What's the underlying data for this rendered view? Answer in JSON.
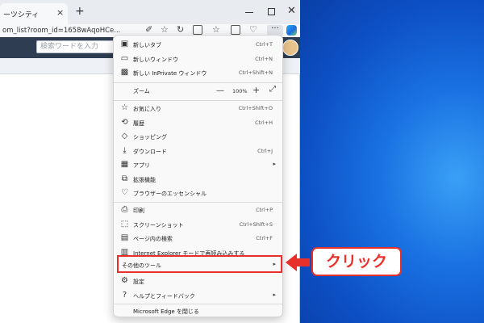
{
  "browser": {
    "tab_title": "ーツシティ",
    "tab_close": "×",
    "new_tab": "+",
    "url": "om_list?room_id=1658wAqoHCe...",
    "more_label": "···"
  },
  "site": {
    "search_placeholder": "検索ワードを入力"
  },
  "menu": {
    "items": [
      {
        "label": "新しいタブ",
        "shortcut": "Ctrl+T",
        "icon": "new-tab-icon"
      },
      {
        "label": "新しいウィンドウ",
        "shortcut": "Ctrl+N",
        "icon": "new-window-icon"
      },
      {
        "label": "新しい InPrivate ウィンドウ",
        "shortcut": "Ctrl+Shift+N",
        "icon": "inprivate-icon"
      },
      {
        "label": "ズーム",
        "zoom": "100%",
        "minus": "—",
        "plus": "+"
      },
      {
        "label": "お気に入り",
        "shortcut": "Ctrl+Shift+O",
        "icon": "favorites-icon"
      },
      {
        "label": "履歴",
        "shortcut": "Ctrl+H",
        "icon": "history-icon"
      },
      {
        "label": "ショッピング",
        "shortcut": "",
        "icon": "shopping-icon"
      },
      {
        "label": "ダウンロード",
        "shortcut": "Ctrl+J",
        "icon": "download-icon"
      },
      {
        "label": "アプリ",
        "shortcut": "",
        "icon": "apps-icon"
      },
      {
        "label": "拡張機能",
        "shortcut": "",
        "icon": "extensions-icon"
      },
      {
        "label": "ブラウザーのエッセンシャル",
        "shortcut": "",
        "icon": "essentials-icon"
      },
      {
        "label": "印刷",
        "shortcut": "Ctrl+P",
        "icon": "print-icon"
      },
      {
        "label": "スクリーンショット",
        "shortcut": "Ctrl+Shift+S",
        "icon": "screenshot-icon"
      },
      {
        "label": "ページ内の検索",
        "shortcut": "Ctrl+F",
        "icon": "find-icon"
      },
      {
        "label": "Internet Explorer モードで再読み込みする",
        "shortcut": "",
        "icon": "ie-mode-icon"
      },
      {
        "label": "その他のツール",
        "shortcut": "",
        "icon": ""
      },
      {
        "label": "設定",
        "shortcut": "",
        "icon": "settings-icon"
      },
      {
        "label": "ヘルプとフィードバック",
        "shortcut": "",
        "icon": "help-icon"
      },
      {
        "label": "Microsoft Edge を閉じる",
        "shortcut": ""
      }
    ]
  },
  "callout": {
    "label": "クリック"
  },
  "colors": {
    "highlight": "#e8302a",
    "desktop": "#1a72e2"
  }
}
